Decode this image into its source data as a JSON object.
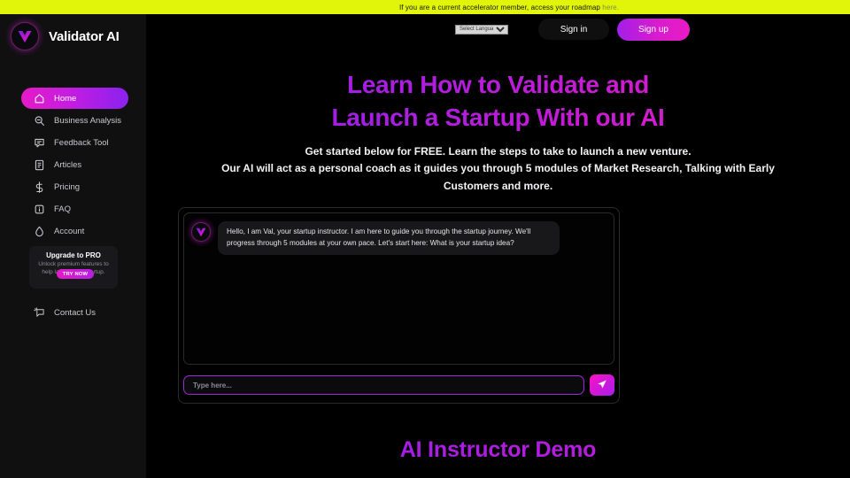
{
  "banner": {
    "text": "If you are a current accelerator member, access your roadmap ",
    "link_label": "here.",
    "bg_color": "#e1f50a"
  },
  "brand": {
    "name": "Validator AI",
    "logo_icon": "validator-v-logo"
  },
  "header": {
    "language_select": {
      "selected": "Select Language",
      "options": [
        "Select Language"
      ]
    },
    "sign_in_label": "Sign in",
    "sign_up_label": "Sign up",
    "accent_color": "#d81ccd"
  },
  "sidebar": {
    "items": [
      {
        "label": "Home",
        "icon": "home-icon",
        "active": true
      },
      {
        "label": "Business Analysis",
        "icon": "search-icon",
        "active": false
      },
      {
        "label": "Feedback Tool",
        "icon": "message-icon",
        "active": false
      },
      {
        "label": "Articles",
        "icon": "document-icon",
        "active": false
      },
      {
        "label": "Pricing",
        "icon": "dollar-icon",
        "active": false
      },
      {
        "label": "FAQ",
        "icon": "info-icon",
        "active": false
      },
      {
        "label": "Account",
        "icon": "bolt-icon",
        "active": false
      }
    ],
    "contact": {
      "label": "Contact Us",
      "icon": "contact-icon"
    },
    "upgrade": {
      "title": "Upgrade to PRO",
      "subtitle": "Unlock premium features to help launch your startup.",
      "button_label": "TRY NOW"
    }
  },
  "hero": {
    "title_line1": "Learn How to Validate and",
    "title_line2": "Launch a Startup With our AI",
    "subtitle_line1": "Get started below for FREE. Learn the steps to take to launch a new venture.",
    "subtitle_line2": "Our AI will act as a personal coach as it guides you through 5 modules of Market Research, Talking with Early Customers and more.",
    "gradient_from": "#8a20ef",
    "gradient_to": "#e41ac6"
  },
  "chat": {
    "avatar_icon": "validator-v-logo",
    "message": "Hello, I am Val, your startup instructor.  I am here to guide you through the startup journey.  We'll progress through 5 modules at your own pace. Let's start here:  What is your startup idea?",
    "input_value": "",
    "input_placeholder": "Type here...",
    "send_icon": "send-paper-plane-icon"
  },
  "demo": {
    "title": "AI Instructor Demo"
  }
}
